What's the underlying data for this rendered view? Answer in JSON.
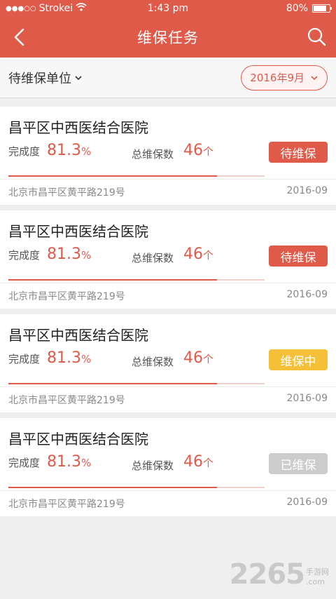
{
  "status_bar": {
    "carrier": "Strokei",
    "time": "1:43 pm",
    "battery": "80%",
    "battery_level": 0.8
  },
  "nav": {
    "title": "维保任务"
  },
  "filter": {
    "category_label": "待维保单位",
    "month_label": "2016年9月"
  },
  "colors": {
    "accent": "#e05a4a",
    "status_pending": "#e05a4a",
    "status_in_progress": "#f4c037",
    "status_done": "#cccccc"
  },
  "tasks": [
    {
      "name": "昌平区中西医结合医院",
      "completion_label": "完成度",
      "completion_value": "81.3",
      "completion_unit": "%",
      "completion_fraction": 0.813,
      "count_label": "总维保数",
      "count_value": "46",
      "count_unit": "个",
      "status": "待维保",
      "status_color": "#e05a4a",
      "address": "北京市昌平区黄平路219号",
      "date": "2016-09"
    },
    {
      "name": "昌平区中西医结合医院",
      "completion_label": "完成度",
      "completion_value": "81.3",
      "completion_unit": "%",
      "completion_fraction": 0.813,
      "count_label": "总维保数",
      "count_value": "46",
      "count_unit": "个",
      "status": "待维保",
      "status_color": "#e05a4a",
      "address": "北京市昌平区黄平路219号",
      "date": "2016-09"
    },
    {
      "name": "昌平区中西医结合医院",
      "completion_label": "完成度",
      "completion_value": "81.3",
      "completion_unit": "%",
      "completion_fraction": 0.813,
      "count_label": "总维保数",
      "count_value": "46",
      "count_unit": "个",
      "status": "维保中",
      "status_color": "#f4c037",
      "address": "北京市昌平区黄平路219号",
      "date": "2016-09"
    },
    {
      "name": "昌平区中西医结合医院",
      "completion_label": "完成度",
      "completion_value": "81.3",
      "completion_unit": "%",
      "completion_fraction": 0.813,
      "count_label": "总维保数",
      "count_value": "46",
      "count_unit": "个",
      "status": "已维保",
      "status_color": "#cccccc",
      "address": "北京市昌平区黄平路219号",
      "date": "2016-09"
    }
  ],
  "watermark": {
    "number": "2265",
    "cn": "手游网",
    "domain": ".com"
  }
}
